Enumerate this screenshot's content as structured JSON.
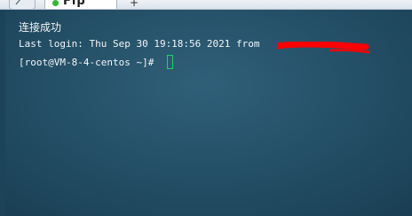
{
  "tabs": {
    "active_label": "Fip",
    "new_tab_label": "+",
    "status_color": "#33b833"
  },
  "terminal": {
    "lines": [
      "连接成功",
      "Last login: Thu Sep 30 19:18:56 2021 from ",
      "[root@VM-8-4-centos ~]# "
    ],
    "redaction_color": "#ff0000",
    "cursor_color": "#1fd36b"
  }
}
